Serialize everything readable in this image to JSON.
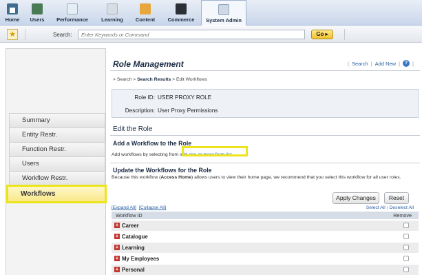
{
  "nav": {
    "items": [
      {
        "label": "Home",
        "icon": "home-icon"
      },
      {
        "label": "Users",
        "icon": "users-icon"
      },
      {
        "label": "Performance",
        "icon": "performance-icon"
      },
      {
        "label": "Learning",
        "icon": "learning-icon"
      },
      {
        "label": "Content",
        "icon": "content-icon"
      },
      {
        "label": "Commerce",
        "icon": "commerce-icon"
      },
      {
        "label": "System Admin",
        "icon": "system-admin-icon"
      }
    ],
    "active": "System Admin"
  },
  "search": {
    "label": "Search:",
    "placeholder": "Enter Keywords or Command",
    "go_label": "Go"
  },
  "sidebar": {
    "items": [
      {
        "label": "Summary"
      },
      {
        "label": "Entity Restr."
      },
      {
        "label": "Function Restr."
      },
      {
        "label": "Users"
      },
      {
        "label": "Workflow Restr."
      },
      {
        "label": "Workflows"
      }
    ],
    "active": "Workflows"
  },
  "main": {
    "title": "Role Management",
    "links": {
      "search": "Search",
      "add_new": "Add New"
    },
    "breadcrumb": {
      "prefix": "> Search > ",
      "current": "Search Results",
      "suffix": " > Edit Workflows"
    },
    "role_id_label": "Role ID:",
    "role_id": "USER PROXY ROLE",
    "description_label": "Description:",
    "description": "User Proxy Permissions",
    "edit_heading": "Edit the Role",
    "add_heading": "Add a Workflow to the Role",
    "add_hint_prefix": "Add workflows by selecting from ",
    "add_link": "add one or more from list.",
    "update_heading": "Update the Workflows for the Role",
    "note_prefix": "Because this workflow (",
    "note_bold": "Access Home",
    "note_suffix": ") allows users to view their home page, we recommend that you select this workflow for all user roles.",
    "apply_label": "Apply Changes",
    "reset_label": "Reset",
    "expand_all": "[Expand All]",
    "collapse_all": "[Collapse All]",
    "select_all": "Select All",
    "deselect_all": "Deselect All",
    "col_workflow": "Workflow ID",
    "col_remove": "Remove",
    "rows": [
      {
        "name": "Career"
      },
      {
        "name": "Catalogue"
      },
      {
        "name": "Learning"
      },
      {
        "name": "My Employees"
      },
      {
        "name": "Personal"
      }
    ]
  },
  "colors": {
    "highlight": "#ece51b",
    "link": "#2a5fa5",
    "accent": "#1b2b44"
  }
}
